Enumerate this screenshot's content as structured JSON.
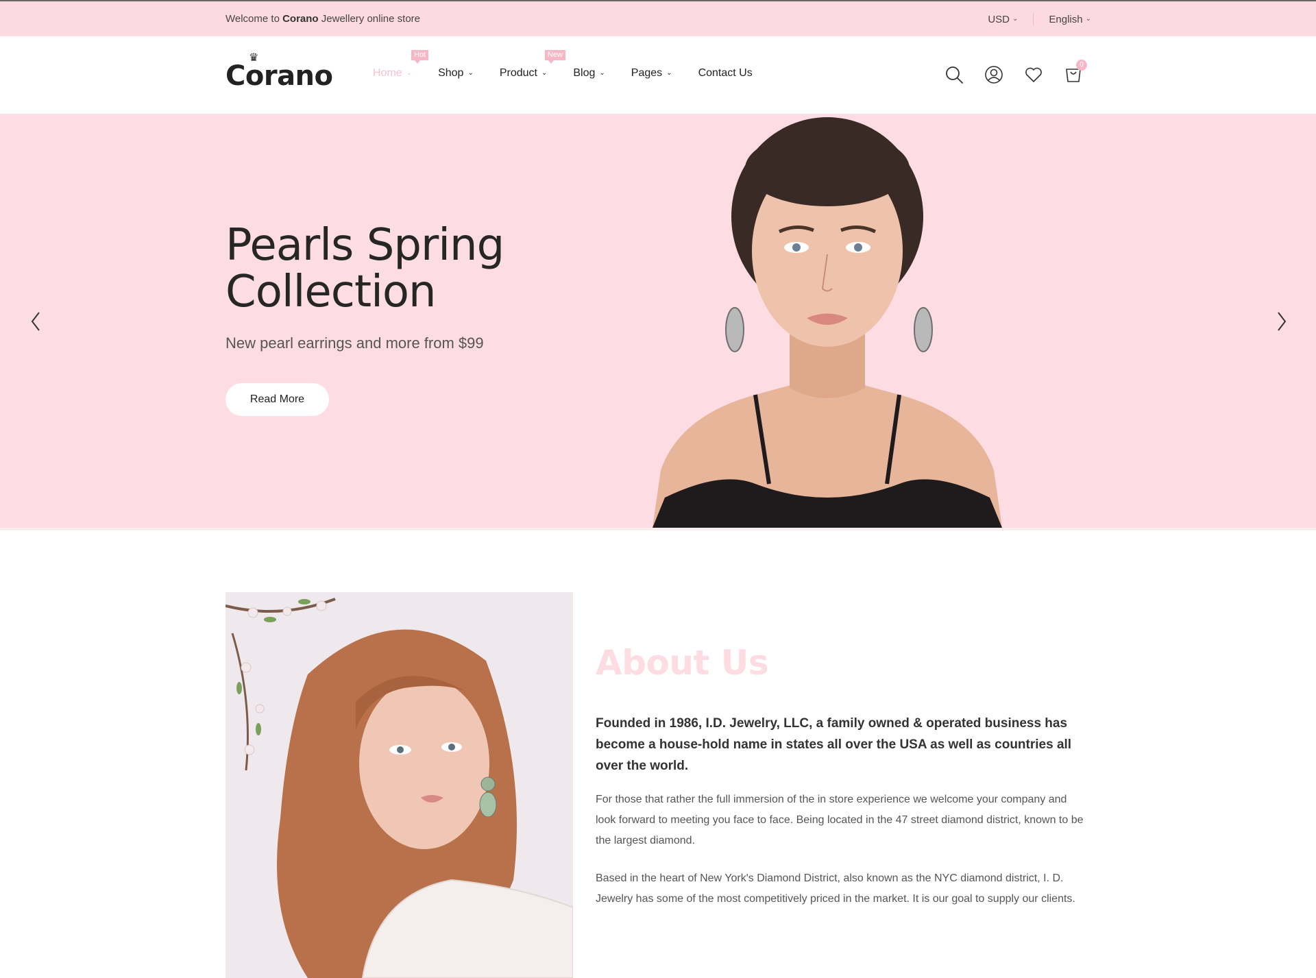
{
  "topbar": {
    "welcome_prefix": "Welcome to",
    "welcome_brand": "Corano",
    "welcome_suffix": "Jewellery online store",
    "currency": "USD",
    "language": "English"
  },
  "header": {
    "logo": "Corano",
    "nav": [
      {
        "label": "Home",
        "badge": "Hot",
        "active": true,
        "dropdown": true
      },
      {
        "label": "Shop",
        "dropdown": true
      },
      {
        "label": "Product",
        "badge": "New",
        "dropdown": true
      },
      {
        "label": "Blog",
        "dropdown": true
      },
      {
        "label": "Pages",
        "dropdown": true
      },
      {
        "label": "Contact Us"
      }
    ],
    "icons": [
      "search-icon",
      "user-icon",
      "heart-icon",
      "cart-icon"
    ],
    "cart_count": "0"
  },
  "hero": {
    "title": "Pearls Spring Collection",
    "subtitle": "New pearl earrings and more from $99",
    "button": "Read More"
  },
  "about": {
    "title": "About Us",
    "lead": "Founded in 1986, I.D. Jewelry, LLC, a family owned & operated business has become a house-hold name in states all over the USA as well as countries all over the world.",
    "p1": "For those that rather the full immersion of the in store experience we welcome your company and look forward to meeting you face to face. Being located in the 47 street diamond district, known to be the largest diamond.",
    "p2": "Based in the heart of New York's Diamond District, also known as the NYC diamond district, I. D. Jewelry has some of the most competitively priced in the market. It is our goal to supply our clients."
  },
  "colors": {
    "accent_pink": "#fddce3",
    "badge_pink": "#f8b7c6",
    "text_dark": "#222222"
  }
}
